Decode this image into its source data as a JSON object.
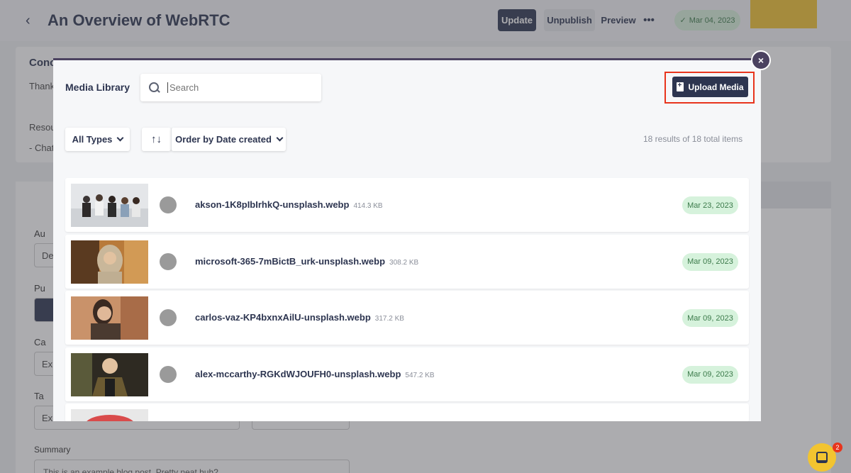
{
  "header": {
    "back_icon": "chevron-left-icon",
    "title": "An Overview of WebRTC",
    "update_label": "Update",
    "unpublish_label": "Unpublish",
    "preview_label": "Preview",
    "more_label": "•••",
    "date_check": "✓",
    "date": "Mar 04, 2023"
  },
  "background": {
    "conclusion": "Conc",
    "thank": "Thank",
    "resou": "Resou",
    "chat": "- Chat",
    "au": "Au",
    "de": "De",
    "pu": "Pu",
    "ca": "Ca",
    "ex1": "Ex",
    "ta": "Ta",
    "ex2": "Ex",
    "summary_label": "Summary",
    "summary_text": "This is an example blog post. Pretty neat huh?"
  },
  "modal": {
    "title": "Media Library",
    "search_placeholder": "Search",
    "upload_label": "Upload Media",
    "types_label": "All Types",
    "sort_icon": "↑↓",
    "order_label": "Order by Date created",
    "results": "18 results of 18 total items",
    "close_label": "×"
  },
  "items": [
    {
      "name": "akson-1K8pIbIrhkQ-unsplash.webp",
      "size": "414.3 KB",
      "date": "Mar 23, 2023"
    },
    {
      "name": "microsoft-365-7mBictB_urk-unsplash.webp",
      "size": "308.2 KB",
      "date": "Mar 09, 2023"
    },
    {
      "name": "carlos-vaz-KP4bxnxAilU-unsplash.webp",
      "size": "317.2 KB",
      "date": "Mar 09, 2023"
    },
    {
      "name": "alex-mccarthy-RGKdWJOUFH0-unsplash.webp",
      "size": "547.2 KB",
      "date": "Mar 09, 2023"
    }
  ],
  "chat": {
    "badge": "2"
  },
  "colors": {
    "primary": "#2d3550",
    "highlight": "#e8341c",
    "date_pill": "#d6f2dc",
    "accent_yellow": "#f2c430"
  }
}
